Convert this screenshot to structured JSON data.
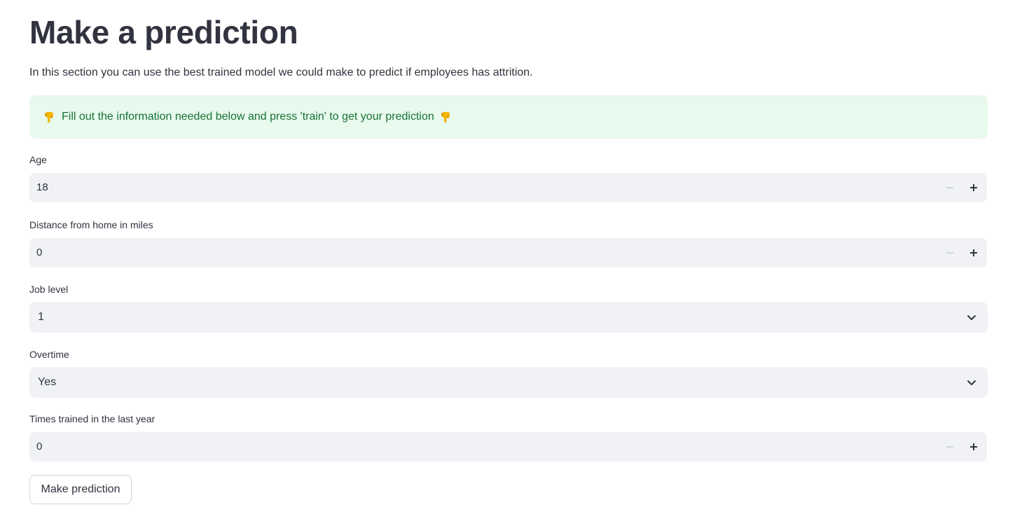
{
  "page": {
    "title": "Make a prediction",
    "intro": "In this section you can use the best trained model we could make to predict if employees has attrition."
  },
  "alert": {
    "text": "Fill out the information needed below and press 'train' to get your prediction",
    "icon": "backhand-pointing-down-emoji",
    "background": "#e8f9ee",
    "text_color": "#177233"
  },
  "fields": {
    "age": {
      "label": "Age",
      "value": "18"
    },
    "distance": {
      "label": "Distance from home in miles",
      "value": "0"
    },
    "job_level": {
      "label": "Job level",
      "value": "1"
    },
    "overtime": {
      "label": "Overtime",
      "value": "Yes"
    },
    "trainings": {
      "label": "Times trained in the last year",
      "value": "0"
    }
  },
  "actions": {
    "predict_label": "Make prediction"
  },
  "colors": {
    "input_background": "#f0f2f6",
    "text": "#31333f"
  }
}
